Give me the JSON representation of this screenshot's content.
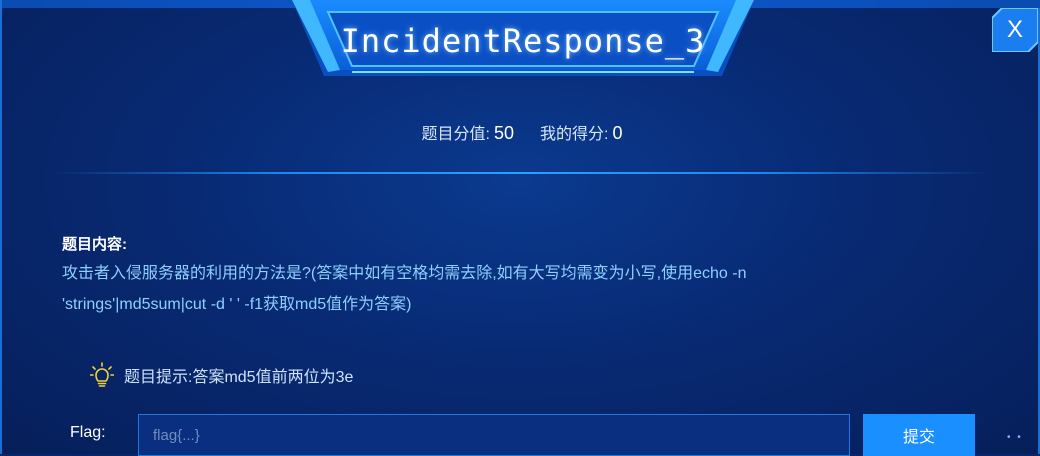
{
  "dialog": {
    "title": "IncidentResponse_3",
    "close_label": "X"
  },
  "score": {
    "value_label": "题目分值:",
    "value": "50",
    "my_label": "我的得分:",
    "my_value": "0"
  },
  "content": {
    "label": "题目内容:",
    "text": "攻击者入侵服务器的利用的方法是?(答案中如有空格均需去除,如有大写均需变为小写,使用echo -n 'strings'|md5sum|cut -d ' ' -f1获取md5值作为答案)"
  },
  "hint": {
    "icon": "lightbulb-icon",
    "text": "题目提示:答案md5值前两位为3e"
  },
  "flag": {
    "label": "Flag:",
    "placeholder": "flag{...}",
    "value": ""
  },
  "submit": {
    "label": "提交"
  },
  "colors": {
    "background": "#08266b",
    "accent": "#1a8fff",
    "content_text": "#8fd0ff",
    "border": "#1e7ad8"
  }
}
